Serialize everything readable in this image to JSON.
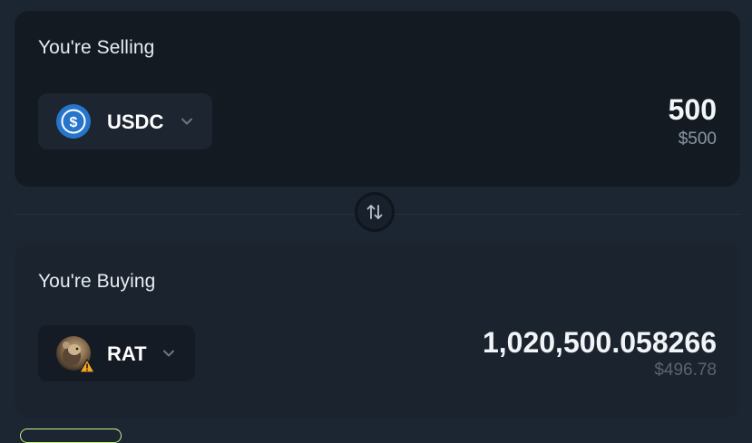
{
  "sell": {
    "title": "You're Selling",
    "token": {
      "symbol": "USDC",
      "icon": "usdc-icon"
    },
    "amount": "500",
    "usd_value": "$500"
  },
  "buy": {
    "title": "You're Buying",
    "token": {
      "symbol": "RAT",
      "icon": "rat-icon"
    },
    "amount": "1,020,500.058266",
    "usd_value": "$496.78"
  },
  "swap_button": {
    "icon": "swap-arrows-icon"
  },
  "colors": {
    "page_bg": "#1c2632",
    "sell_card_bg": "#141a22",
    "buy_card_bg": "#1b232e",
    "usdc_blue": "#2775ca",
    "warning_orange": "#f5a623"
  }
}
